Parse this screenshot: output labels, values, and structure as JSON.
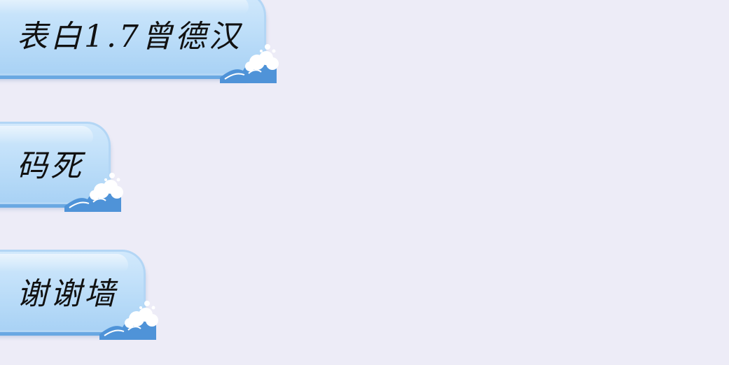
{
  "messages": [
    {
      "text": "表白1.7曾德汉"
    },
    {
      "text": "码死"
    },
    {
      "text": "谢谢墙"
    }
  ],
  "colors": {
    "background": "#edecf7",
    "bubble_light": "#d2e9fc",
    "bubble_dark": "#a9d2f5",
    "bubble_shadow": "#6aa8e2",
    "wave_blue": "#4f93d8",
    "text": "#111111"
  },
  "icons": {
    "bubble_decoration": "wave-cloud-icon"
  }
}
